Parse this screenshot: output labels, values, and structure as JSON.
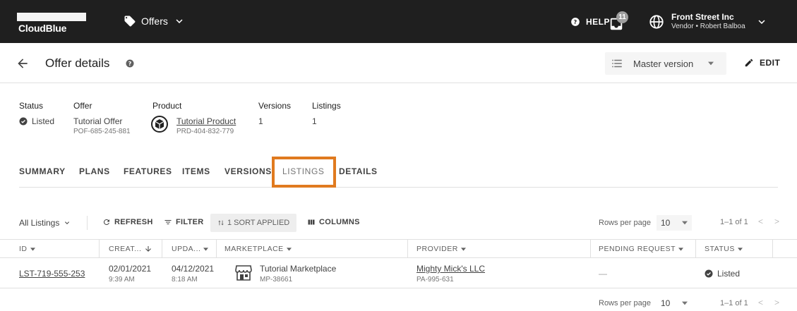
{
  "topbar": {
    "brand": "CloudBlue",
    "module": "Offers",
    "help": "HELP",
    "notifications_count": "11",
    "account_company": "Front Street Inc",
    "account_role": "Vendor • Robert Balboa"
  },
  "header": {
    "title": "Offer details",
    "version": "Master version",
    "edit": "EDIT"
  },
  "summary": {
    "status_label": "Status",
    "status_value": "Listed",
    "offer_label": "Offer",
    "offer_name": "Tutorial Offer",
    "offer_id": "POF-685-245-881",
    "product_label": "Product",
    "product_name": "Tutorial Product",
    "product_id": "PRD-404-832-779",
    "versions_label": "Versions",
    "versions_value": "1",
    "listings_label": "Listings",
    "listings_value": "1"
  },
  "tabs": [
    {
      "label": "SUMMARY"
    },
    {
      "label": "PLANS"
    },
    {
      "label": "FEATURES"
    },
    {
      "label": "ITEMS"
    },
    {
      "label": "VERSIONS"
    },
    {
      "label": "LISTINGS",
      "active": true
    },
    {
      "label": "DETAILS"
    }
  ],
  "toolbar": {
    "view": "All Listings",
    "refresh": "REFRESH",
    "filter": "FILTER",
    "sort": "1 SORT APPLIED",
    "columns": "COLUMNS",
    "rows_per_page_label": "Rows per page",
    "rows_per_page": "10",
    "range": "1–1 of 1"
  },
  "table": {
    "columns": [
      "ID",
      "CREAT...",
      "UPDA...",
      "MARKETPLACE",
      "PROVIDER",
      "PENDING REQUEST",
      "STATUS"
    ],
    "rows": [
      {
        "id": "LST-719-555-253",
        "created_date": "02/01/2021",
        "created_time": "9:39 AM",
        "updated_date": "04/12/2021",
        "updated_time": "8:18 AM",
        "marketplace": "Tutorial Marketplace",
        "marketplace_id": "MP-38661",
        "provider": "Mighty Mick's LLC",
        "provider_id": "PA-995-631",
        "pending_request": "—",
        "status": "Listed"
      }
    ]
  },
  "footer": {
    "rows_per_page_label": "Rows per page",
    "rows_per_page": "10",
    "range": "1–1 of 1"
  },
  "colors": {
    "topbar": "#1f1f1f",
    "highlight": "#e07a1f"
  }
}
